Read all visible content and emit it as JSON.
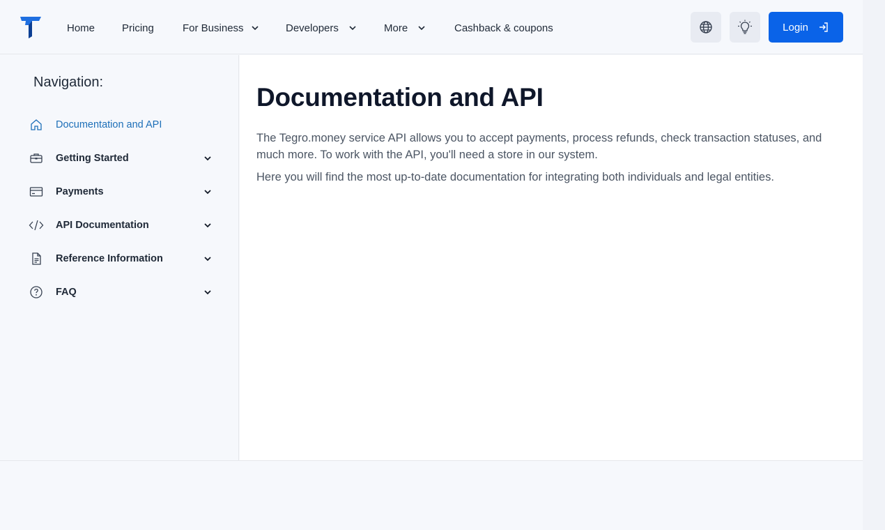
{
  "header": {
    "nav": [
      {
        "label": "Home"
      },
      {
        "label": "Pricing"
      },
      {
        "label": "For Business"
      },
      {
        "label": "Developers"
      },
      {
        "label": "More"
      },
      {
        "label": "Cashback & coupons"
      }
    ],
    "login_label": "Login"
  },
  "sidebar": {
    "title": "Navigation:",
    "items": [
      {
        "label": "Documentation and API",
        "icon": "home-icon"
      },
      {
        "label": "Getting Started",
        "icon": "briefcase-icon"
      },
      {
        "label": "Payments",
        "icon": "card-icon"
      },
      {
        "label": "API Documentation",
        "icon": "code-icon"
      },
      {
        "label": "Reference Information",
        "icon": "document-icon"
      },
      {
        "label": "FAQ",
        "icon": "help-icon"
      }
    ]
  },
  "main": {
    "title": "Documentation and API",
    "paragraphs": [
      "The Tegro.money service API allows you to accept payments, process refunds, check transaction statuses, and much more. To work with the API, you'll need a store in our system.",
      "Here you will find the most up-to-date documentation for integrating both individuals and legal entities."
    ]
  },
  "colors": {
    "accent": "#0a63e8",
    "active_link": "#1d6fb8",
    "background": "#f6f8fc"
  }
}
